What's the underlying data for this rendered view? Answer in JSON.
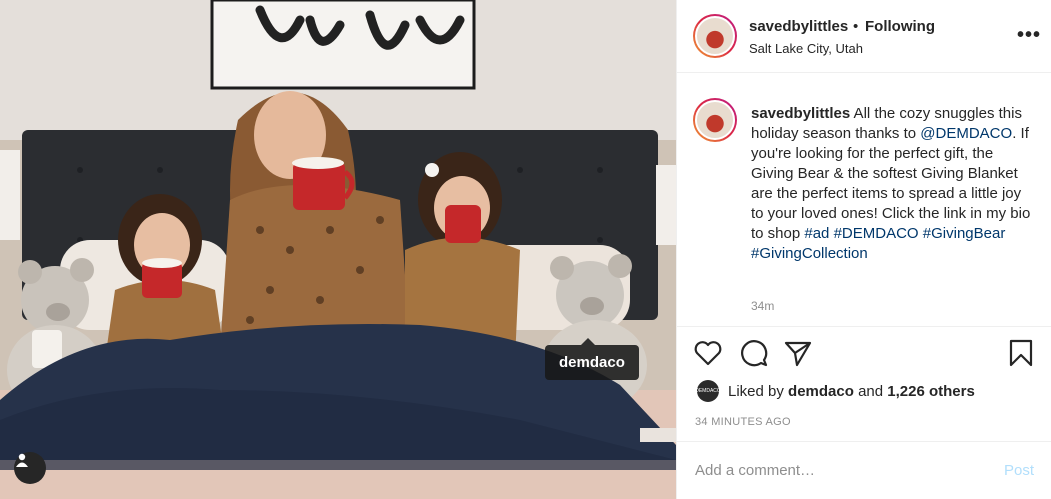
{
  "photo": {
    "tag_label": "demdaco",
    "user_tag_icon": "user-icon"
  },
  "header": {
    "username": "savedbylittles",
    "separator": "•",
    "follow_status": "Following",
    "location": "Salt Lake City, Utah",
    "more_icon": "more-icon",
    "more_label": "•••"
  },
  "caption": {
    "username": "savedbylittles",
    "text_part1": " All the cozy snuggles this holiday season thanks to ",
    "mention": "@DEMDACO",
    "text_part2": ". If you're looking for the perfect gift, the Giving Bear & the softest Giving Blanket are the perfect items to spread a little joy to your loved ones! Click the link in my bio to shop ",
    "hashtags": [
      "#ad",
      "#DEMDACO",
      "#GivingBear",
      "#GivingCollection"
    ],
    "time": "34m"
  },
  "actions": {
    "like_icon": "heart-icon",
    "comment_icon": "comment-icon",
    "share_icon": "share-icon",
    "save_icon": "bookmark-icon"
  },
  "likes": {
    "avatar_label": "DEMDACO",
    "prefix": "Liked by ",
    "user": "demdaco",
    "middle": " and ",
    "count": "1,226 others"
  },
  "timestamp": "34 MINUTES AGO",
  "comment": {
    "placeholder": "Add a comment…",
    "post_label": "Post"
  }
}
